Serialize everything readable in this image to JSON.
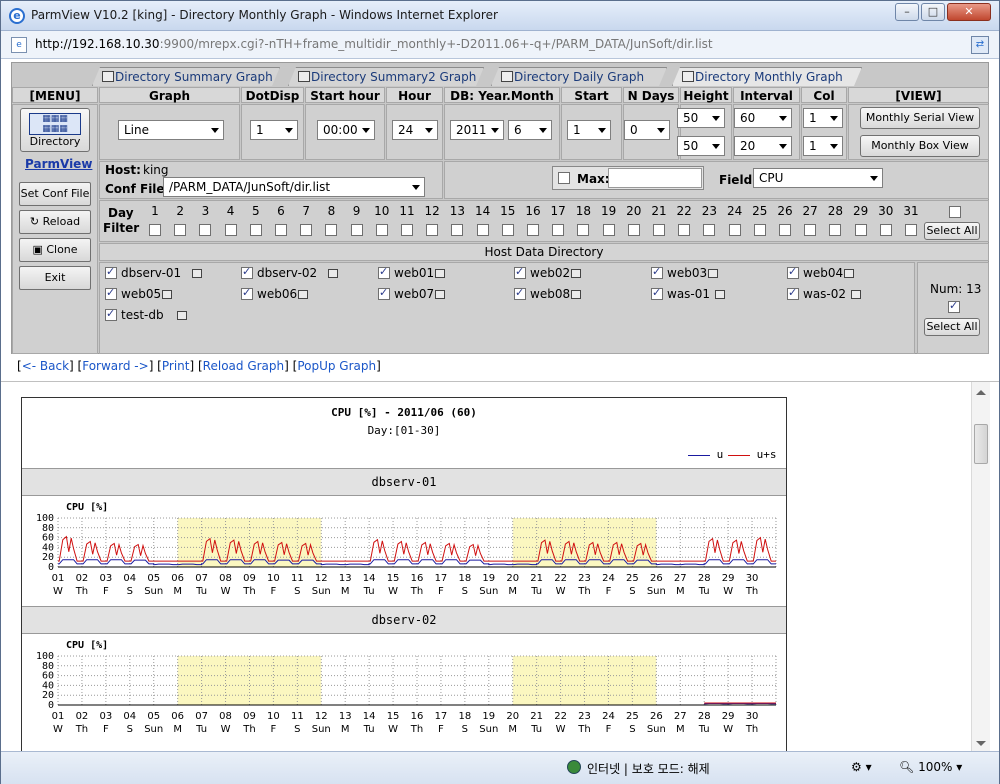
{
  "window": {
    "title": "ParmView V10.2 [king] - Directory Monthly Graph - Windows Internet Explorer"
  },
  "address": {
    "url_host": "http://192.168.10.30",
    "url_rest": ":9900/mrepx.cgi?-nTH+frame_multidir_monthly+-D2011.06+-q+/PARM_DATA/JunSoft/dir.list"
  },
  "tabs": [
    {
      "label": "Directory Summary Graph"
    },
    {
      "label": "Directory Summary2 Graph"
    },
    {
      "label": "Directory Daily Graph"
    },
    {
      "label": "Directory Monthly Graph"
    }
  ],
  "headers": {
    "menu": "[MENU]",
    "graph": "Graph",
    "dotdisp": "DotDisp",
    "starthour": "Start hour",
    "hour": "Hour",
    "dbym": "DB: Year.Month",
    "startday": "Start Day",
    "ndays": "N Days",
    "height": "Height",
    "interval": "Interval",
    "col": "Col",
    "view": "[VIEW]"
  },
  "menu": {
    "directory": "Directory",
    "parmview": "ParmView",
    "setconf": "Set Conf File",
    "reload": "Reload",
    "clone": "Clone",
    "exit": "Exit"
  },
  "controls": {
    "graph": "Line",
    "dotdisp": "1",
    "starthour": "00:00",
    "hour": "24",
    "year": "2011",
    "month": "6",
    "startday": "1",
    "ndays": "0",
    "height1": "50",
    "height2": "50",
    "interval1": "60",
    "interval2": "20",
    "col1": "1",
    "col2": "1"
  },
  "view": {
    "serial": "Monthly Serial View",
    "box": "Monthly Box View"
  },
  "host": {
    "label": "Host:",
    "value": "king",
    "conf_label": "Conf File:",
    "conf_value": "/PARM_DATA/JunSoft/dir.list"
  },
  "max": {
    "label": "Max:"
  },
  "field": {
    "label": "Field:",
    "value": "CPU"
  },
  "dayfilter": {
    "label1": "Day",
    "label2": "Filter",
    "select_all": "Select All",
    "days": [
      "1",
      "2",
      "3",
      "4",
      "5",
      "6",
      "7",
      "8",
      "9",
      "10",
      "11",
      "12",
      "13",
      "14",
      "15",
      "16",
      "17",
      "18",
      "19",
      "20",
      "21",
      "22",
      "23",
      "24",
      "25",
      "26",
      "27",
      "28",
      "29",
      "30",
      "31"
    ]
  },
  "hostdir": {
    "title": "Host Data Directory",
    "num_label": "Num: 13",
    "select_all": "Select All",
    "hosts": [
      "dbserv-01",
      "dbserv-02",
      "web01",
      "web02",
      "web03",
      "web04",
      "web05",
      "web06",
      "web07",
      "web08",
      "was-01",
      "was-02",
      "test-db"
    ]
  },
  "links": {
    "back": "<- Back",
    "forward": "Forward ->",
    "print": "Print",
    "reload": "Reload Graph",
    "popup": "PopUp Graph"
  },
  "graph": {
    "title": "CPU [%] - 2011/06 (60)",
    "subtitle": "Day:[01-30]",
    "legend": [
      {
        "name": "u",
        "color": "#1a1aa0"
      },
      {
        "name": "u+s",
        "color": "#d01010"
      }
    ],
    "ylabel": "CPU [%]",
    "yticks": [
      "100",
      "80",
      "60",
      "40",
      "20",
      "0"
    ],
    "days": [
      "01",
      "02",
      "03",
      "04",
      "05",
      "06",
      "07",
      "08",
      "09",
      "10",
      "11",
      "12",
      "13",
      "14",
      "15",
      "16",
      "17",
      "18",
      "19",
      "20",
      "21",
      "22",
      "23",
      "24",
      "25",
      "26",
      "27",
      "28",
      "29",
      "30"
    ],
    "weekdays": [
      "W",
      "Th",
      "F",
      "S",
      "Sun",
      "M",
      "Tu",
      "W",
      "Th",
      "F",
      "S",
      "Sun",
      "M",
      "Tu",
      "W",
      "Th",
      "F",
      "S",
      "Sun",
      "M",
      "Tu",
      "W",
      "Th",
      "F",
      "S",
      "Sun",
      "M",
      "Tu",
      "W",
      "Th"
    ],
    "panels": [
      {
        "host": "dbserv-01"
      },
      {
        "host": "dbserv-02"
      }
    ],
    "shade_color": "#fbf7c0"
  },
  "status": {
    "zone": "인터넷 | 보호 모드: 해제",
    "zoom": "100%"
  },
  "chart_data": [
    {
      "type": "line",
      "title": "CPU [%] - 2011/06 (60)",
      "subtitle": "Day:[01-30]",
      "panel": "dbserv-01",
      "ylabel": "CPU [%]",
      "ylim": [
        0,
        100
      ],
      "x": [
        "01",
        "02",
        "03",
        "04",
        "05",
        "06",
        "07",
        "08",
        "09",
        "10",
        "11",
        "12",
        "13",
        "14",
        "15",
        "16",
        "17",
        "18",
        "19",
        "20",
        "21",
        "22",
        "23",
        "24",
        "25",
        "26",
        "27",
        "28",
        "29",
        "30"
      ],
      "series": [
        {
          "name": "u",
          "values": [
            15,
            15,
            15,
            14,
            6,
            6,
            15,
            15,
            15,
            14,
            14,
            6,
            6,
            15,
            15,
            15,
            15,
            14,
            6,
            6,
            15,
            15,
            15,
            15,
            14,
            6,
            6,
            15,
            15,
            15
          ]
        },
        {
          "name": "u+s",
          "values": [
            62,
            52,
            48,
            46,
            12,
            12,
            58,
            55,
            52,
            50,
            48,
            12,
            12,
            56,
            52,
            50,
            48,
            46,
            12,
            12,
            55,
            52,
            50,
            50,
            48,
            12,
            12,
            58,
            55,
            60
          ]
        }
      ]
    },
    {
      "type": "line",
      "panel": "dbserv-02",
      "ylabel": "CPU [%]",
      "ylim": [
        0,
        100
      ],
      "x": [
        "01",
        "02",
        "03",
        "04",
        "05",
        "06",
        "07",
        "08",
        "09",
        "10",
        "11",
        "12",
        "13",
        "14",
        "15",
        "16",
        "17",
        "18",
        "19",
        "20",
        "21",
        "22",
        "23",
        "24",
        "25",
        "26",
        "27",
        "28",
        "29",
        "30"
      ],
      "series": [
        {
          "name": "u",
          "values": [
            null,
            null,
            null,
            null,
            null,
            null,
            null,
            null,
            null,
            null,
            null,
            null,
            null,
            null,
            null,
            null,
            null,
            null,
            null,
            null,
            null,
            null,
            null,
            null,
            null,
            null,
            null,
            3,
            3,
            3
          ]
        },
        {
          "name": "u+s",
          "values": [
            null,
            null,
            null,
            null,
            null,
            null,
            null,
            null,
            null,
            null,
            null,
            null,
            null,
            null,
            null,
            null,
            null,
            null,
            null,
            null,
            null,
            null,
            null,
            null,
            null,
            null,
            null,
            4,
            4,
            4
          ]
        }
      ]
    }
  ]
}
